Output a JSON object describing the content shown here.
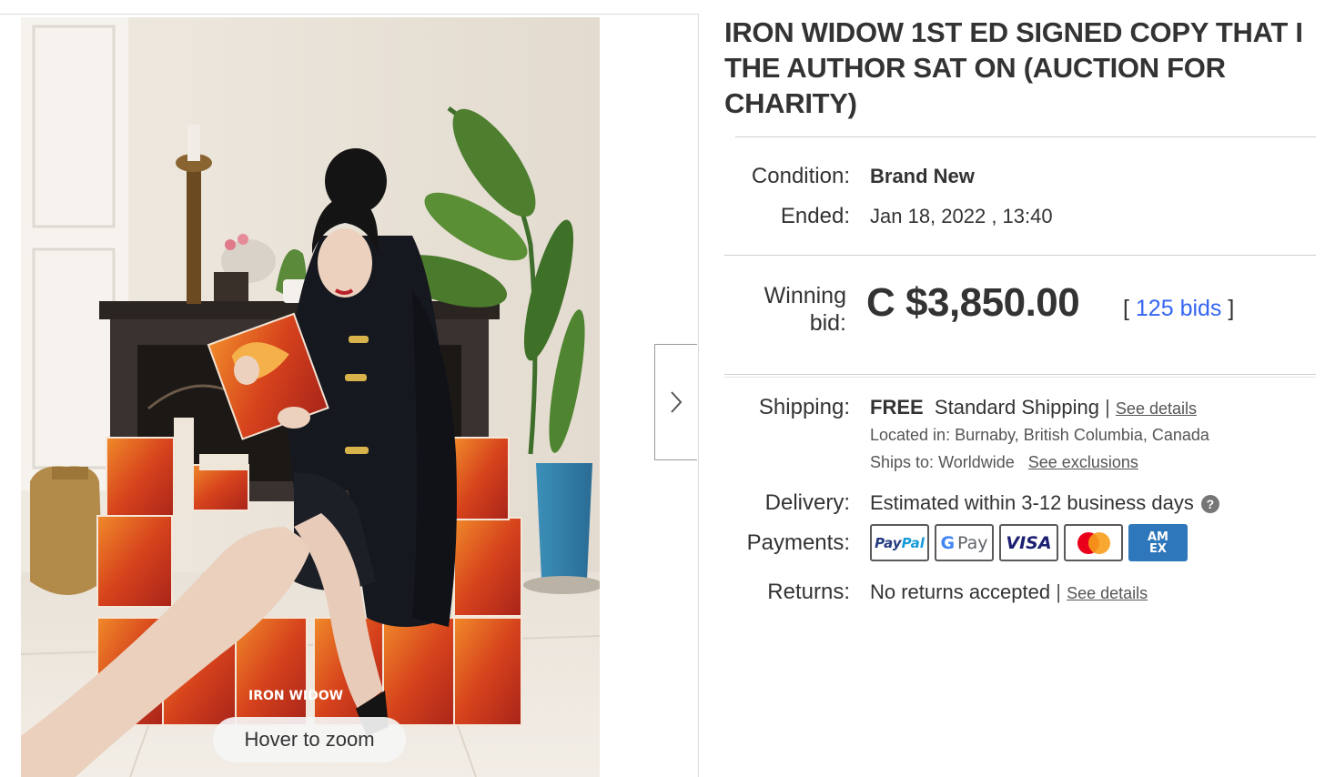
{
  "gallery": {
    "zoom_hint": "Hover to zoom",
    "book_spine_text": "IRON WIDOW"
  },
  "listing": {
    "title": "IRON WIDOW 1ST ED SIGNED COPY THAT I THE AUTHOR SAT ON (AUCTION FOR CHARITY)",
    "condition_label": "Condition:",
    "condition_value": "Brand New",
    "ended_label": "Ended:",
    "ended_value": "Jan 18, 2022 , 13:40",
    "winning_bid_label": "Winning bid:",
    "winning_bid_value": "C $3,850.00",
    "bids_open": "[",
    "bids_link": "125 bids",
    "bids_close": "]",
    "shipping_label": "Shipping:",
    "shipping_free": "FREE",
    "shipping_method": "Standard Shipping",
    "shipping_sep": "|",
    "shipping_details_link": "See details",
    "located_label": "Located in:",
    "located_value": "Burnaby, British Columbia, Canada",
    "ships_to_label": "Ships to:",
    "ships_to_value": "Worldwide",
    "exclusions_link": "See exclusions",
    "delivery_label": "Delivery:",
    "delivery_value": "Estimated within 3-12 business days",
    "delivery_help": "?",
    "payments_label": "Payments:",
    "payment_methods": {
      "paypal_a": "Pay",
      "paypal_b": "Pal",
      "gpay_g": "G",
      "gpay_pay": "Pay",
      "visa": "VISA",
      "amex": "AM EX"
    },
    "returns_label": "Returns:",
    "returns_value": "No returns accepted",
    "returns_sep": "|",
    "returns_details_link": "See details"
  },
  "colors": {
    "link_blue": "#3665f3",
    "text": "#333333",
    "amex_blue": "#2e77bb",
    "paypal_dark": "#253b80",
    "paypal_light": "#179bd7",
    "visa_blue": "#1a1f71"
  },
  "icons": {
    "next": "chevron-right-icon",
    "help": "question-circle-icon"
  }
}
